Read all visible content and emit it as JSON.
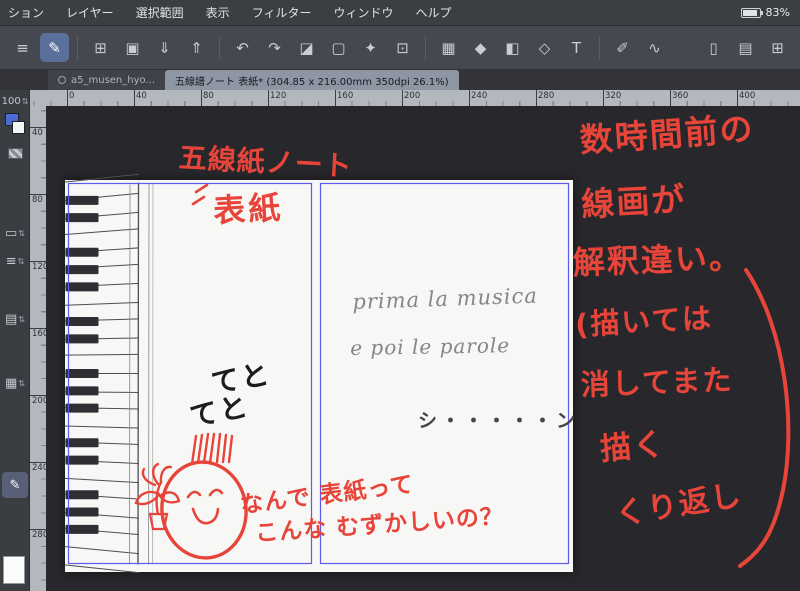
{
  "menubar": {
    "items": [
      "ション",
      "レイヤー",
      "選択範囲",
      "表示",
      "フィルター",
      "ウィンドウ",
      "ヘルプ"
    ],
    "battery": "83%"
  },
  "toolbar": {
    "main_icons": [
      {
        "name": "main-menu-icon",
        "glyph": "≡"
      },
      {
        "name": "pen-tool-icon",
        "glyph": "✎",
        "active": true
      },
      {
        "name": "separator"
      },
      {
        "name": "new-canvas-icon",
        "glyph": "⊞"
      },
      {
        "name": "open-folder-icon",
        "glyph": "▣"
      },
      {
        "name": "save-icon",
        "glyph": "⇓"
      },
      {
        "name": "export-icon",
        "glyph": "⇑"
      },
      {
        "name": "separator"
      },
      {
        "name": "undo-icon",
        "glyph": "↶"
      },
      {
        "name": "redo-icon",
        "glyph": "↷"
      },
      {
        "name": "eraser-icon",
        "glyph": "◪"
      },
      {
        "name": "selection-icon",
        "glyph": "▢"
      },
      {
        "name": "magic-wand-icon",
        "glyph": "✦"
      },
      {
        "name": "crop-icon",
        "glyph": "⊡"
      },
      {
        "name": "separator"
      },
      {
        "name": "screentone-icon",
        "glyph": "▦"
      },
      {
        "name": "fill-icon",
        "glyph": "◆"
      },
      {
        "name": "gradient-icon",
        "glyph": "◧"
      },
      {
        "name": "shape-icon",
        "glyph": "◇"
      },
      {
        "name": "text-icon",
        "glyph": "T"
      },
      {
        "name": "separator"
      },
      {
        "name": "ruler-pen-icon",
        "glyph": "✐"
      },
      {
        "name": "curve-ruler-icon",
        "glyph": "∿"
      }
    ],
    "right_icons": [
      {
        "name": "device-icon",
        "glyph": "▯"
      },
      {
        "name": "pages-icon",
        "glyph": "▤"
      },
      {
        "name": "workspace-grid-icon",
        "glyph": "⊞"
      }
    ]
  },
  "tabs": [
    {
      "label": "a5_musen_hyo...",
      "active": false
    },
    {
      "label": "五線譜ノート 表紙* (304.85 x 216.00mm 350dpi 26.1%)",
      "active": true
    }
  ],
  "rulers": {
    "horizontal": [
      "0",
      "40",
      "80",
      "120",
      "160",
      "200",
      "240",
      "280",
      "320",
      "360",
      "400"
    ],
    "vertical": [
      "40",
      "80",
      "120",
      "160",
      "200",
      "240",
      "280"
    ]
  },
  "left_toolbar": {
    "brush_size": "100",
    "items": [
      {
        "name": "brush-size-stepper"
      },
      {
        "name": "color-swatches"
      },
      {
        "name": "transparent-color-icon"
      },
      {
        "name": "subtool-stepper-1",
        "glyph": "▭",
        "spin": true
      },
      {
        "name": "subtool-stepper-2",
        "glyph": "≡",
        "spin": true
      },
      {
        "name": "layer-stepper",
        "glyph": "▤",
        "spin": true
      },
      {
        "name": "material-stepper",
        "glyph": "▦",
        "spin": true
      },
      {
        "name": "active-pen-icon",
        "glyph": "✎",
        "selected": true
      },
      {
        "name": "navigator-thumbnail"
      }
    ]
  },
  "canvas": {
    "pencil_lyric_line1": "prima la musica",
    "pencil_lyric_line2": "e poi le parole",
    "sfx_steps_1": "てと",
    "sfx_steps_2": "てと",
    "sfx_silence": "シ・・・・・ン",
    "red_notes": {
      "title_line1": "五線紙ノート",
      "title_line2": "表紙",
      "side_lines": [
        "数時間前の",
        "線画が",
        "解釈違い。",
        "(描いては",
        "消してまた",
        "描く",
        "くり返し"
      ],
      "bottom_line1": "なんで 表紙って",
      "bottom_line2": "こんな むずかしいの？"
    }
  }
}
